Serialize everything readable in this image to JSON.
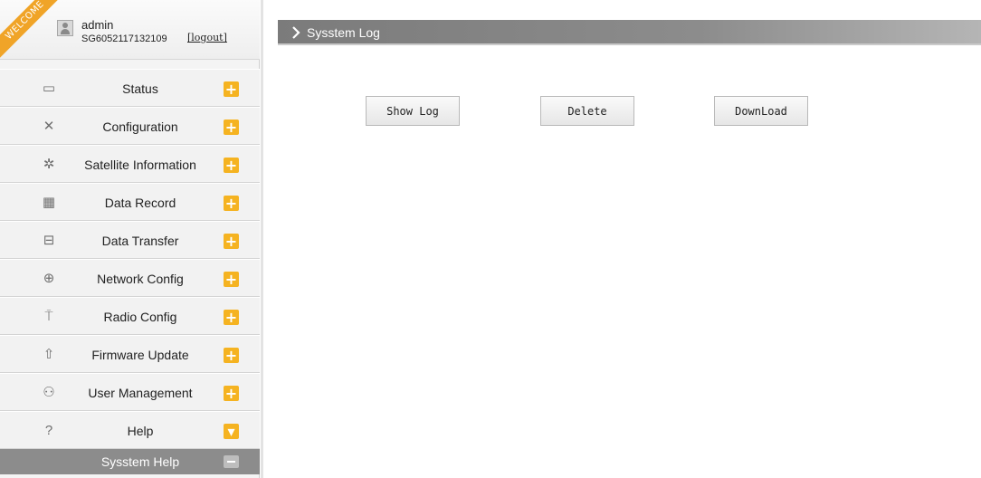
{
  "user": {
    "ribbon": "WELCOME",
    "name": "admin",
    "serial": "SG6052117132109",
    "logout": "[logout]"
  },
  "menu": [
    {
      "label": "Status",
      "icon": "monitor-icon",
      "glyph": "▭",
      "toggle": "+"
    },
    {
      "label": "Configuration",
      "icon": "tools-icon",
      "glyph": "✕",
      "toggle": "+"
    },
    {
      "label": "Satellite Information",
      "icon": "satellite-icon",
      "glyph": "✲",
      "toggle": "+"
    },
    {
      "label": "Data Record",
      "icon": "calendar-icon",
      "glyph": "▦",
      "toggle": "+"
    },
    {
      "label": "Data Transfer",
      "icon": "network-icon",
      "glyph": "⊟",
      "toggle": "+"
    },
    {
      "label": "Network Config",
      "icon": "globe-icon",
      "glyph": "⊕",
      "toggle": "+"
    },
    {
      "label": "Radio Config",
      "icon": "antenna-icon",
      "glyph": "⍑",
      "toggle": "+"
    },
    {
      "label": "Firmware Update",
      "icon": "upload-icon",
      "glyph": "⇧",
      "toggle": "+"
    },
    {
      "label": "User Management",
      "icon": "users-icon",
      "glyph": "⚇",
      "toggle": "+"
    },
    {
      "label": "Help",
      "icon": "question-icon",
      "glyph": "?",
      "toggle": "▾"
    }
  ],
  "submenu": {
    "label": "Sysstem Help"
  },
  "header": {
    "title": "Sysstem Log"
  },
  "buttons": {
    "show_log": "Show Log",
    "delete": "Delete",
    "download": "DownLoad"
  },
  "colors": {
    "accent": "#f5b321",
    "header_bar": "#8c8c8c",
    "sidebar_bg": "#f2f2f2"
  }
}
